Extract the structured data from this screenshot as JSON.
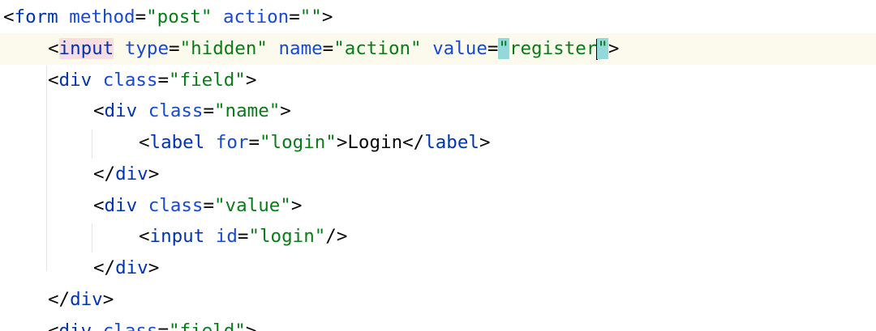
{
  "editor": {
    "lines": [
      {
        "segments": [
          {
            "text": "<",
            "kind": "p"
          },
          {
            "text": "form",
            "kind": "t"
          },
          {
            "text": " ",
            "kind": "p"
          },
          {
            "text": "method",
            "kind": "a"
          },
          {
            "text": "=",
            "kind": "p"
          },
          {
            "text": "\"post\"",
            "kind": "v"
          },
          {
            "text": " ",
            "kind": "p"
          },
          {
            "text": "action",
            "kind": "a"
          },
          {
            "text": "=",
            "kind": "p"
          },
          {
            "text": "\"\"",
            "kind": "v"
          },
          {
            "text": ">",
            "kind": "p"
          }
        ]
      },
      {
        "segments": [
          {
            "text": "<",
            "kind": "p"
          },
          {
            "text": "input",
            "kind": "t"
          },
          {
            "text": " ",
            "kind": "p"
          },
          {
            "text": "type",
            "kind": "a"
          },
          {
            "text": "=",
            "kind": "p"
          },
          {
            "text": "\"hidden\"",
            "kind": "v"
          },
          {
            "text": " ",
            "kind": "p"
          },
          {
            "text": "name",
            "kind": "a"
          },
          {
            "text": "=",
            "kind": "p"
          },
          {
            "text": "\"action\"",
            "kind": "v"
          },
          {
            "text": " ",
            "kind": "p"
          },
          {
            "text": "value",
            "kind": "a"
          },
          {
            "text": "=",
            "kind": "p"
          },
          {
            "text": "\"",
            "kind": "v"
          },
          {
            "text": "register",
            "kind": "v"
          },
          {
            "text": "\"",
            "kind": "v"
          },
          {
            "text": ">",
            "kind": "p"
          }
        ]
      },
      {
        "segments": [
          {
            "text": "<",
            "kind": "p"
          },
          {
            "text": "div",
            "kind": "t"
          },
          {
            "text": " ",
            "kind": "p"
          },
          {
            "text": "class",
            "kind": "a"
          },
          {
            "text": "=",
            "kind": "p"
          },
          {
            "text": "\"field\"",
            "kind": "v"
          },
          {
            "text": ">",
            "kind": "p"
          }
        ]
      },
      {
        "segments": [
          {
            "text": "<",
            "kind": "p"
          },
          {
            "text": "div",
            "kind": "t"
          },
          {
            "text": " ",
            "kind": "p"
          },
          {
            "text": "class",
            "kind": "a"
          },
          {
            "text": "=",
            "kind": "p"
          },
          {
            "text": "\"name\"",
            "kind": "v"
          },
          {
            "text": ">",
            "kind": "p"
          }
        ]
      },
      {
        "segments": [
          {
            "text": "<",
            "kind": "p"
          },
          {
            "text": "label",
            "kind": "t"
          },
          {
            "text": " ",
            "kind": "p"
          },
          {
            "text": "for",
            "kind": "a"
          },
          {
            "text": "=",
            "kind": "p"
          },
          {
            "text": "\"login\"",
            "kind": "v"
          },
          {
            "text": ">",
            "kind": "p"
          },
          {
            "text": "Login",
            "kind": "x"
          },
          {
            "text": "</",
            "kind": "p"
          },
          {
            "text": "label",
            "kind": "t"
          },
          {
            "text": ">",
            "kind": "p"
          }
        ]
      },
      {
        "segments": [
          {
            "text": "</",
            "kind": "p"
          },
          {
            "text": "div",
            "kind": "t"
          },
          {
            "text": ">",
            "kind": "p"
          }
        ]
      },
      {
        "segments": [
          {
            "text": "<",
            "kind": "p"
          },
          {
            "text": "div",
            "kind": "t"
          },
          {
            "text": " ",
            "kind": "p"
          },
          {
            "text": "class",
            "kind": "a"
          },
          {
            "text": "=",
            "kind": "p"
          },
          {
            "text": "\"value\"",
            "kind": "v"
          },
          {
            "text": ">",
            "kind": "p"
          }
        ]
      },
      {
        "segments": [
          {
            "text": "<",
            "kind": "p"
          },
          {
            "text": "input",
            "kind": "t"
          },
          {
            "text": " ",
            "kind": "p"
          },
          {
            "text": "id",
            "kind": "a"
          },
          {
            "text": "=",
            "kind": "p"
          },
          {
            "text": "\"login\"",
            "kind": "v"
          },
          {
            "text": "/>",
            "kind": "p"
          }
        ]
      },
      {
        "segments": [
          {
            "text": "</",
            "kind": "p"
          },
          {
            "text": "div",
            "kind": "t"
          },
          {
            "text": ">",
            "kind": "p"
          }
        ]
      },
      {
        "segments": [
          {
            "text": "</",
            "kind": "p"
          },
          {
            "text": "div",
            "kind": "t"
          },
          {
            "text": ">",
            "kind": "p"
          }
        ]
      },
      {
        "segments": [
          {
            "text": "<",
            "kind": "p"
          },
          {
            "text": "div",
            "kind": "t"
          },
          {
            "text": " ",
            "kind": "p"
          },
          {
            "text": "class",
            "kind": "a"
          },
          {
            "text": "=",
            "kind": "p"
          },
          {
            "text": "\"field\"",
            "kind": "v"
          },
          {
            "text": ">",
            "kind": "p"
          }
        ]
      }
    ]
  },
  "colors": {
    "tag": "#0033b3",
    "attribute": "#174ad4",
    "string": "#067d17",
    "text": "#080808",
    "current_line": "#fcfaed",
    "tag_highlight": "#f9dee1",
    "quote_highlight": "#93d9d9"
  }
}
